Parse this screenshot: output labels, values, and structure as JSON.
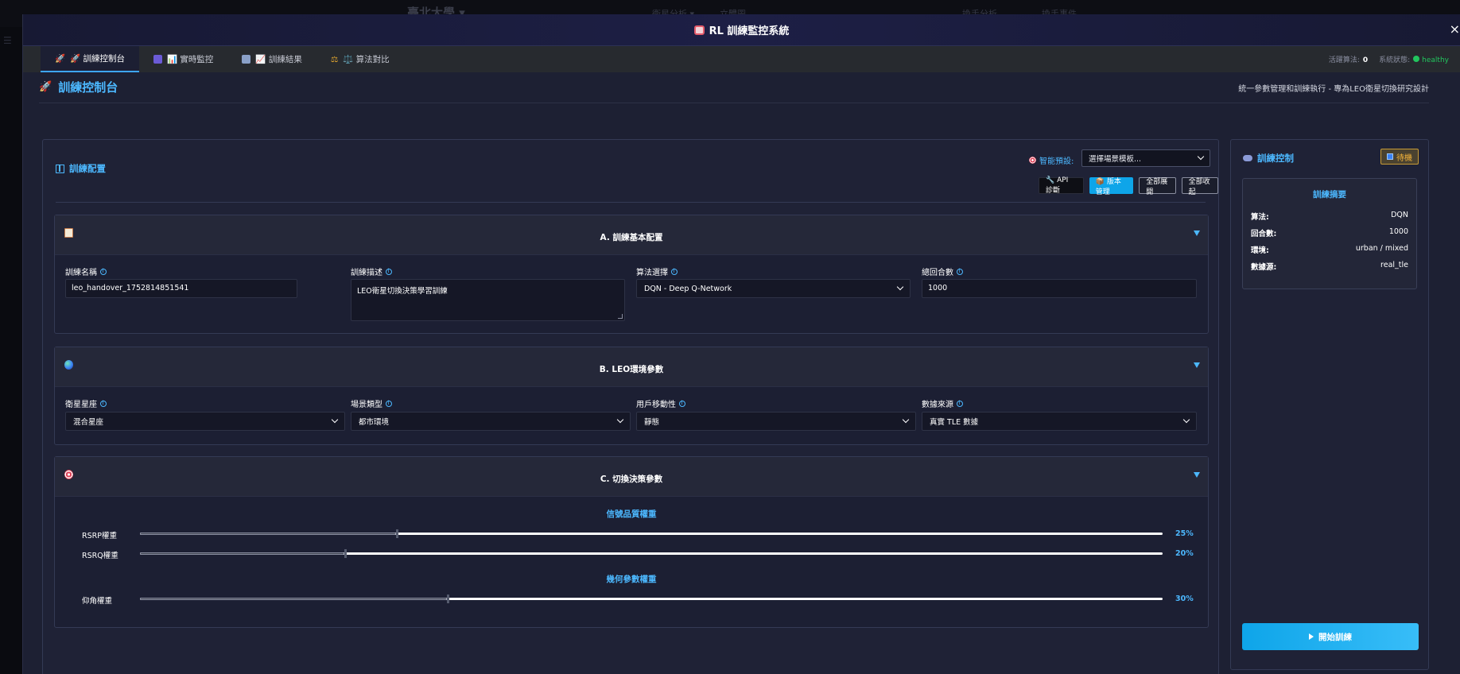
{
  "background": {
    "title": "臺北大學 ▾",
    "nav": [
      "衛星分析 ▾",
      "立體圖",
      "立體圖",
      "3D 衛星",
      "換手分析",
      "換手事件"
    ]
  },
  "modal": {
    "title": "RL 訓練監控系統",
    "close": "×"
  },
  "tabs": [
    {
      "label": "🚀 訓練控制台"
    },
    {
      "label": "📊 實時監控"
    },
    {
      "label": "📈 訓練結果"
    },
    {
      "label": "⚖️ 算法對比"
    }
  ],
  "status": {
    "active_label": "活躍算法:",
    "active_value": "0",
    "system_label": "系統狀態:",
    "system_value": "healthy"
  },
  "page": {
    "title": "訓練控制台",
    "subtitle": "統一參數管理和訓練執行 - 專為LEO衛星切換研究設計"
  },
  "config": {
    "heading": "訓練配置",
    "preset_label": "智能預設:",
    "preset_value": "選擇場景模板...",
    "buttons": {
      "api": "🔧 API 診斷",
      "version": "📦 版本管理",
      "expand": "全部展開",
      "collapse": "全部收起"
    }
  },
  "section_a": {
    "title": "A. 訓練基本配置",
    "name_label": "訓練名稱",
    "name_value": "leo_handover_1752814851541",
    "desc_label": "訓練描述",
    "desc_value": "LEO衛星切換決策學習訓練",
    "algo_label": "算法選擇",
    "algo_value": "DQN - Deep Q-Network",
    "episodes_label": "總回合數",
    "episodes_value": "1000"
  },
  "section_b": {
    "title": "B. LEO環境參數",
    "constellation_label": "衛星星座",
    "constellation_value": "混合星座",
    "scenario_label": "場景類型",
    "scenario_value": "都市環境",
    "mobility_label": "用戶移動性",
    "mobility_value": "靜態",
    "source_label": "數據來源",
    "source_value": "真實 TLE 數據"
  },
  "section_c": {
    "title": "C. 切換決策參數",
    "signal_head": "信號品質權重",
    "geo_head": "幾何參數權重",
    "sliders": [
      {
        "label": "RSRP權重",
        "value": 0.25,
        "display": "25%"
      },
      {
        "label": "RSRQ權重",
        "value": 0.2,
        "display": "20%"
      },
      {
        "label": "仰角權重",
        "value": 0.3,
        "display": "30%"
      }
    ]
  },
  "control": {
    "heading": "訓練控制",
    "badge": "待機",
    "summary_title": "訓練摘要",
    "summary": [
      {
        "key": "算法:",
        "value": "DQN"
      },
      {
        "key": "回合數:",
        "value": "1000"
      },
      {
        "key": "環境:",
        "value": "urban / mixed"
      },
      {
        "key": "數據源:",
        "value": "real_tle"
      }
    ],
    "start": "開始訓練"
  },
  "colors": {
    "accent": "#4cb8ff",
    "primary_button": "#0ea5e9",
    "healthy": "#22c55e",
    "badge": "#f2b23a"
  }
}
